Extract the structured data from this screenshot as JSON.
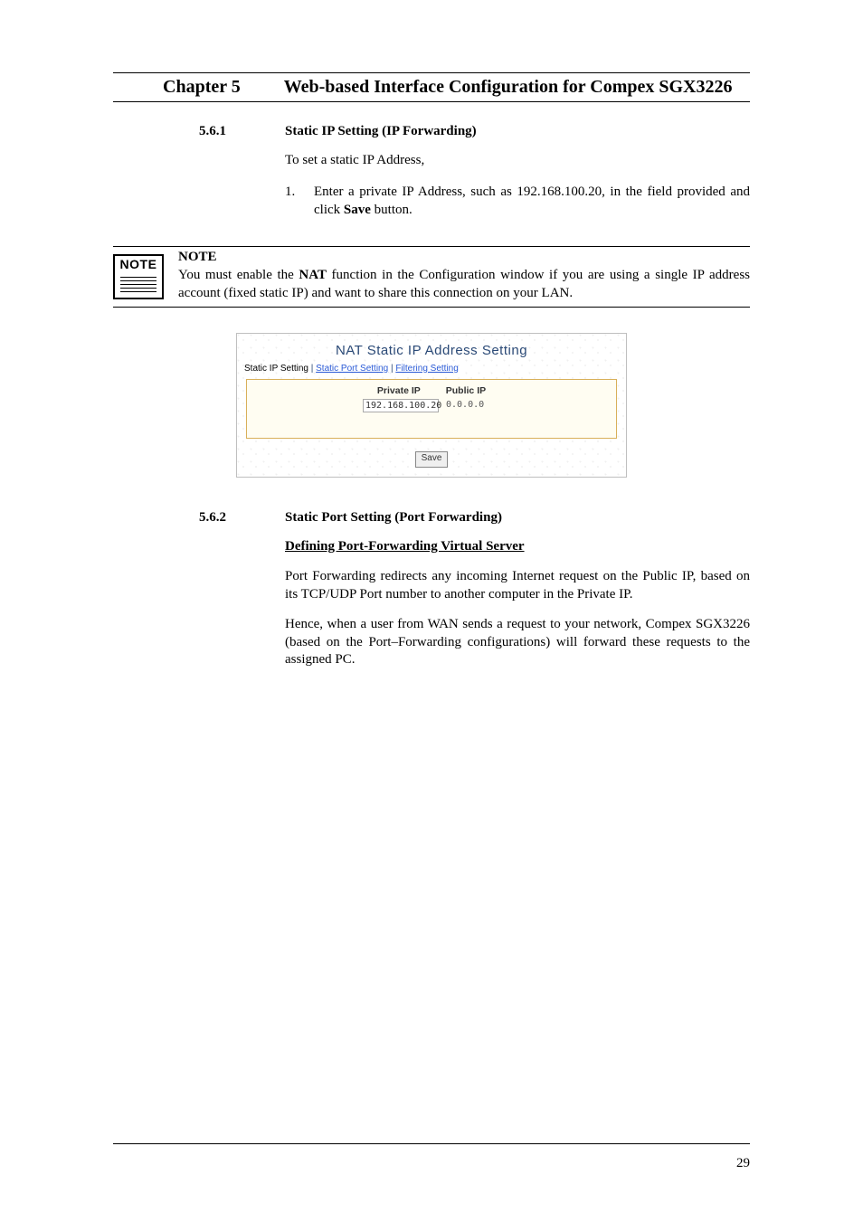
{
  "chapter": {
    "label": "Chapter 5",
    "title": "Web-based Interface Configuration for Compex SGX3226"
  },
  "s1": {
    "num": "5.6.1",
    "title": "Static IP Setting (IP Forwarding)",
    "intro": "To set a static IP Address,",
    "item_num": "1.",
    "item_before": "Enter a private IP Address, such as 192.168.100.20, in the field provided and click ",
    "item_bold": "Save",
    "item_after": " button."
  },
  "note": {
    "icon_word": "NOTE",
    "label": "NOTE",
    "before": "You must enable the ",
    "bold": "NAT",
    "after": " function in the Configuration window if you are using a single IP address account (fixed static IP) and want to share this connection on your LAN."
  },
  "shot": {
    "title": "NAT Static IP Address Setting",
    "tab1": "Static IP Setting",
    "tab2": "Static Port Setting",
    "tab3": "Filtering Setting",
    "sep": " | ",
    "col_private": "Private IP",
    "col_public": "Public IP",
    "private_val": "192.168.100.20",
    "public_val": "0.0.0.0",
    "save": "Save"
  },
  "s2": {
    "num": "5.6.2",
    "title": "Static Port Setting (Port Forwarding)",
    "subhead": "Defining Port-Forwarding Virtual Server",
    "p1": "Port Forwarding redirects any incoming Internet request on the Public IP, based on its TCP/UDP Port number to another computer in the Private IP.",
    "p2": "Hence, when a user from WAN sends a request to your network, Compex SGX3226 (based on the Port–Forwarding configurations) will forward these requests to the assigned PC."
  },
  "page_num": "29"
}
